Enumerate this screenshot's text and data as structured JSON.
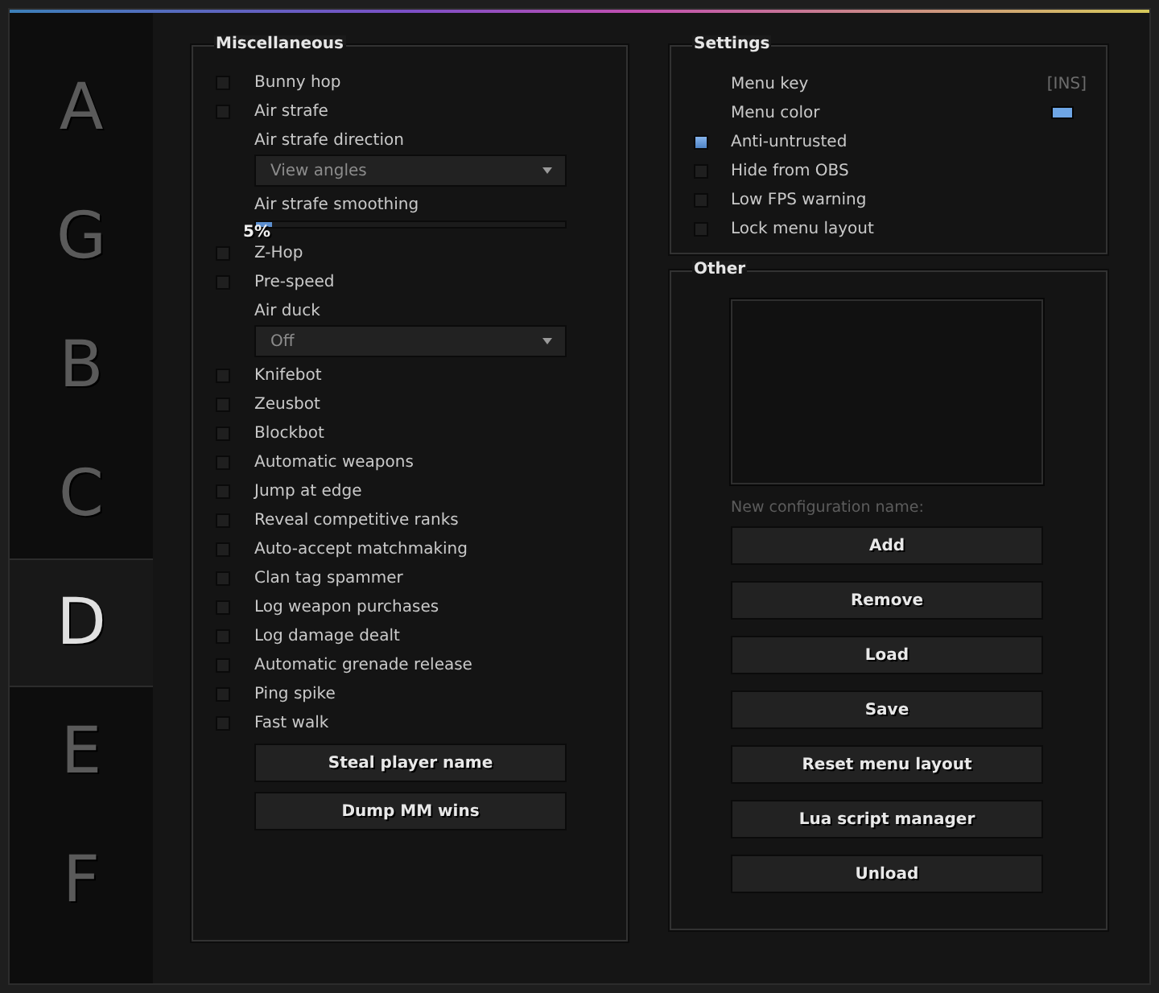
{
  "tabs": [
    {
      "label": "A",
      "selected": false
    },
    {
      "label": "G",
      "selected": false
    },
    {
      "label": "B",
      "selected": false
    },
    {
      "label": "C",
      "selected": false
    },
    {
      "label": "D",
      "selected": true
    },
    {
      "label": "E",
      "selected": false
    },
    {
      "label": "F",
      "selected": false
    }
  ],
  "miscellaneous": {
    "title": "Miscellaneous",
    "items": [
      {
        "kind": "checkbox",
        "label": "Bunny hop",
        "checked": false
      },
      {
        "kind": "checkbox",
        "label": "Air strafe",
        "checked": false
      },
      {
        "kind": "dropdown",
        "label": "Air strafe direction",
        "value": "View angles"
      },
      {
        "kind": "slider",
        "label": "Air strafe smoothing",
        "level": 0.05,
        "reading": "5%"
      },
      {
        "kind": "checkbox",
        "label": "Z-Hop",
        "checked": false
      },
      {
        "kind": "checkbox",
        "label": "Pre-speed",
        "checked": false
      },
      {
        "kind": "dropdown",
        "label": "Air duck",
        "value": "Off"
      },
      {
        "kind": "checkbox",
        "label": "Knifebot",
        "checked": false
      },
      {
        "kind": "checkbox",
        "label": "Zeusbot",
        "checked": false
      },
      {
        "kind": "checkbox",
        "label": "Blockbot",
        "checked": false
      },
      {
        "kind": "checkbox",
        "label": "Automatic weapons",
        "checked": false
      },
      {
        "kind": "checkbox",
        "label": "Jump at edge",
        "checked": false
      },
      {
        "kind": "checkbox",
        "label": "Reveal competitive ranks",
        "checked": false
      },
      {
        "kind": "checkbox",
        "label": "Auto-accept matchmaking",
        "checked": false
      },
      {
        "kind": "checkbox",
        "label": "Clan tag spammer",
        "checked": false
      },
      {
        "kind": "checkbox",
        "label": "Log weapon purchases",
        "checked": false
      },
      {
        "kind": "checkbox",
        "label": "Log damage dealt",
        "checked": false
      },
      {
        "kind": "checkbox",
        "label": "Automatic grenade release",
        "checked": false
      },
      {
        "kind": "checkbox",
        "label": "Ping spike",
        "checked": false
      },
      {
        "kind": "checkbox",
        "label": "Fast walk",
        "checked": false
      },
      {
        "kind": "button",
        "label": "Steal player name"
      },
      {
        "kind": "button",
        "label": "Dump MM wins"
      }
    ]
  },
  "settings": {
    "title": "Settings",
    "items": [
      {
        "kind": "keybind",
        "label": "Menu key",
        "value": "[INS]"
      },
      {
        "kind": "color",
        "label": "Menu color",
        "color": "#6ea6e6"
      },
      {
        "kind": "checkbox",
        "label": "Anti-untrusted",
        "checked": true
      },
      {
        "kind": "checkbox",
        "label": "Hide from OBS",
        "checked": false
      },
      {
        "kind": "checkbox",
        "label": "Low FPS warning",
        "checked": false
      },
      {
        "kind": "checkbox",
        "label": "Lock menu layout",
        "checked": false
      }
    ]
  },
  "other": {
    "title": "Other",
    "config_name": {
      "placeholder": "New configuration name:"
    },
    "buttons": [
      "Add",
      "Remove",
      "Load",
      "Save",
      "Reset menu layout",
      "Lua script manager",
      "Unload"
    ]
  }
}
